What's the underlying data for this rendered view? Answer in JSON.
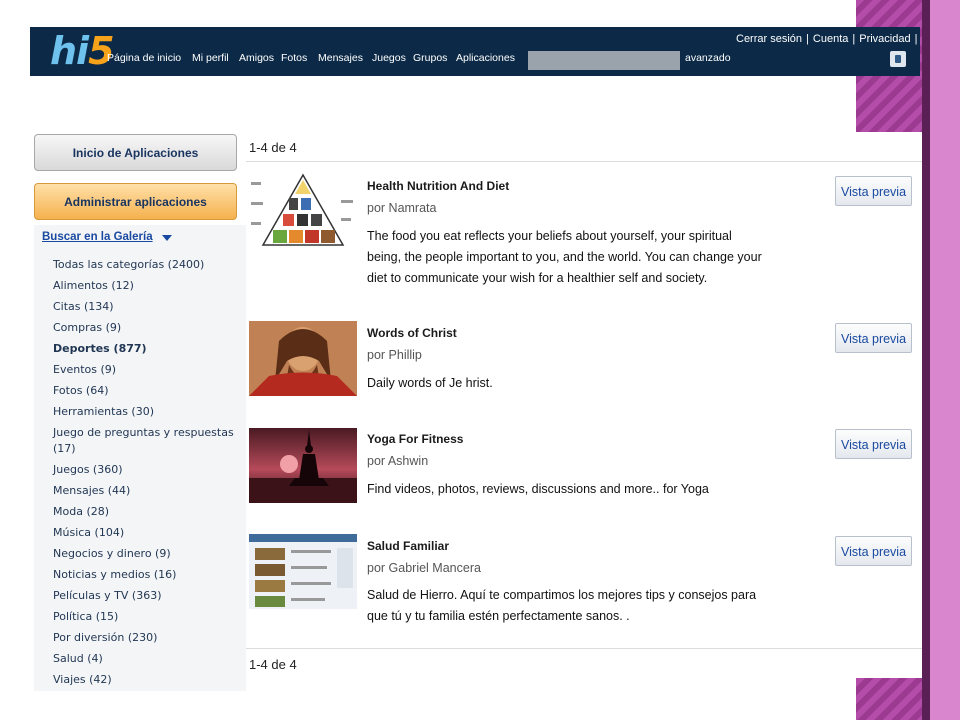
{
  "header": {
    "logo_hi": "hi",
    "logo_5": "5",
    "nav": [
      "Página de inicio",
      "Mi perfil",
      "Amigos",
      "Fotos",
      "Mensajes",
      "Juegos",
      "Grupos",
      "Aplicaciones"
    ],
    "search_value": "",
    "avanzado": "avanzado",
    "top_links": [
      "Cerrar sesión",
      "Cuenta",
      "Privacidad"
    ],
    "separator": "|"
  },
  "sidebar": {
    "home_button": "Inicio de Aplicaciones",
    "manage_button": "Administrar aplicaciones",
    "gallery_link": "Buscar en la Galería",
    "categories": [
      "Todas las categorías (2400)",
      "Alimentos (12)",
      "Citas (134)",
      "Compras (9)",
      "Deportes (877)",
      "Eventos (9)",
      "Fotos (64)",
      "Herramientas (30)",
      "Juego de preguntas y respuestas",
      "(17)",
      "Juegos (360)",
      "Mensajes (44)",
      "Moda (28)",
      "Música (104)",
      "Negocios y dinero (9)",
      "Noticias y medios (16)",
      "Películas y TV (363)",
      "Política (15)",
      "Por diversión (230)",
      "Salud (4)",
      "Viajes (42)"
    ],
    "selected_category": "Deportes (877)"
  },
  "results": {
    "count_top": "1-4 de 4",
    "count_bottom": "1-4 de 4",
    "preview_label": "Vista previa",
    "apps": [
      {
        "title": "Health Nutrition And Diet",
        "author": "por Namrata",
        "description": "The food you eat reflects your beliefs about yourself, your spiritual being, the people important to you, and the world. You can change your diet to communicate your wish for a healthier self and society."
      },
      {
        "title": "Words of Christ",
        "author": "por Phillip",
        "description": "Daily words of Je        hrist."
      },
      {
        "title": "Yoga For Fitness",
        "author": "por Ashwin",
        "description": "Find videos, photos, reviews, discussions and more.. for Yoga"
      },
      {
        "title": "Salud Familiar",
        "author": "por Gabriel Mancera",
        "description": "Salud de Hierro. Aquí te compartimos los mejores tips y consejos para que tú y tu familia estén perfectamente sanos. ."
      }
    ]
  },
  "colors": {
    "topbar": "#0c2a47",
    "logo_hi": "#6fc1ee",
    "logo_5": "#f6a21a",
    "link": "#1a4aa0",
    "deco": "#a6409a",
    "manage_button": "#f5b14e"
  }
}
